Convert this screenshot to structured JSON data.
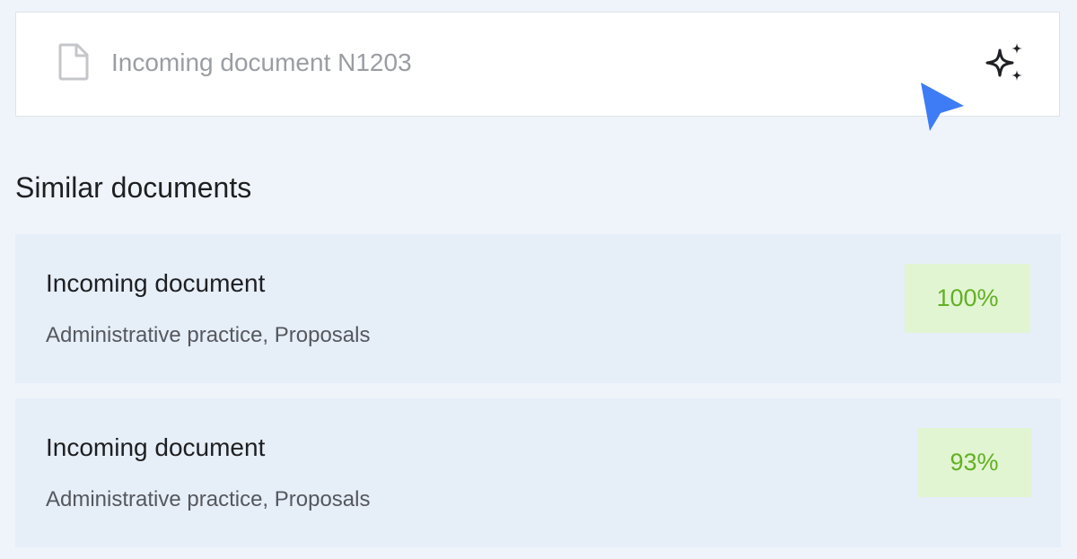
{
  "document": {
    "title": "Incoming document N1203",
    "icon": "document-icon",
    "action_icon": "sparkles-icon"
  },
  "similar": {
    "heading": "Similar documents",
    "items": [
      {
        "title": "Incoming document",
        "tags": "Administrative practice, Proposals",
        "match": "100%"
      },
      {
        "title": "Incoming document",
        "tags": "Administrative practice, Proposals",
        "match": "93%"
      }
    ]
  },
  "colors": {
    "background": "#eff4fb",
    "card": "#e6eef8",
    "badge_bg": "#e2f5d2",
    "badge_text": "#63b024",
    "cursor": "#3d7cf5"
  }
}
